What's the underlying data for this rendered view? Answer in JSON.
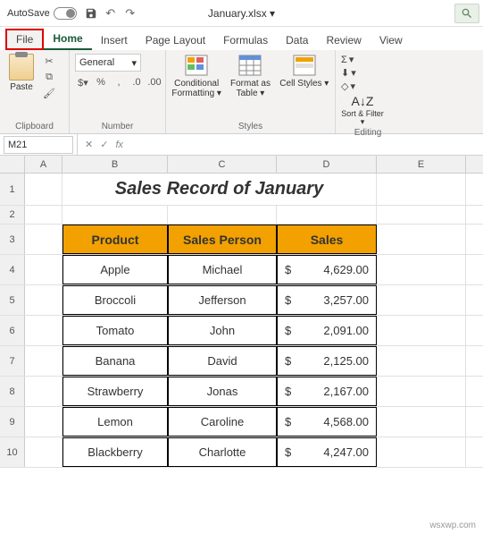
{
  "titlebar": {
    "autosave_label": "AutoSave",
    "autosave_state": "Off",
    "document_name": "January.xlsx  ▾"
  },
  "tabs": {
    "file": "File",
    "home": "Home",
    "insert": "Insert",
    "page_layout": "Page Layout",
    "formulas": "Formulas",
    "data": "Data",
    "review": "Review",
    "view": "View"
  },
  "ribbon": {
    "clipboard": {
      "label": "Clipboard",
      "paste": "Paste"
    },
    "number": {
      "label": "Number",
      "format": "General"
    },
    "styles": {
      "label": "Styles",
      "cond_fmt": "Conditional Formatting ▾",
      "fmt_table": "Format as Table ▾",
      "cell_styles": "Cell Styles ▾"
    },
    "editing": {
      "label": "Editing",
      "sort_filter": "Sort & Filter ▾"
    }
  },
  "formula_bar": {
    "name_box": "M21",
    "fx": "fx"
  },
  "columns": [
    "A",
    "B",
    "C",
    "D",
    "E"
  ],
  "sheet": {
    "title": "Sales Record of January",
    "headers": {
      "product": "Product",
      "person": "Sales Person",
      "sales": "Sales"
    },
    "rows": [
      {
        "product": "Apple",
        "person": "Michael",
        "currency": "$",
        "sales": "4,629.00"
      },
      {
        "product": "Broccoli",
        "person": "Jefferson",
        "currency": "$",
        "sales": "3,257.00"
      },
      {
        "product": "Tomato",
        "person": "John",
        "currency": "$",
        "sales": "2,091.00"
      },
      {
        "product": "Banana",
        "person": "David",
        "currency": "$",
        "sales": "2,125.00"
      },
      {
        "product": "Strawberry",
        "person": "Jonas",
        "currency": "$",
        "sales": "2,167.00"
      },
      {
        "product": "Lemon",
        "person": "Caroline",
        "currency": "$",
        "sales": "4,568.00"
      },
      {
        "product": "Blackberry",
        "person": "Charlotte",
        "currency": "$",
        "sales": "4,247.00"
      }
    ]
  },
  "watermark": "wsxwp.com"
}
